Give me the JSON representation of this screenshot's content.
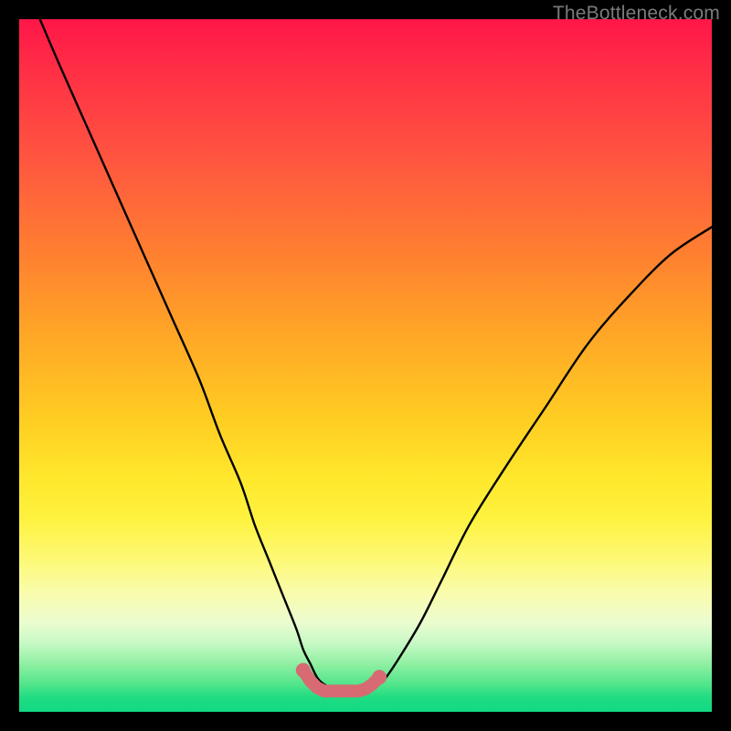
{
  "watermark": "TheBottleneck.com",
  "chart_data": {
    "type": "line",
    "title": "",
    "xlabel": "",
    "ylabel": "",
    "xlim": [
      0,
      100
    ],
    "ylim": [
      0,
      100
    ],
    "series": [
      {
        "name": "curve",
        "x": [
          3,
          6,
          10,
          14,
          18,
          22,
          26,
          29,
          32,
          34,
          36,
          38,
          40,
          41,
          42,
          43,
          44,
          46,
          48,
          50,
          52,
          53,
          55,
          58,
          61,
          65,
          70,
          76,
          82,
          88,
          94,
          100
        ],
        "y": [
          100,
          93,
          84,
          75,
          66,
          57,
          48,
          40,
          33,
          27,
          22,
          17,
          12,
          9,
          7,
          5,
          4,
          3,
          3,
          3,
          4,
          5,
          8,
          13,
          19,
          27,
          35,
          44,
          53,
          60,
          66,
          70
        ]
      },
      {
        "name": "bump-markers",
        "x": [
          41,
          42,
          43,
          44,
          45,
          46,
          47,
          48,
          49,
          50,
          51,
          52
        ],
        "y": [
          6,
          4.5,
          3.5,
          3,
          3,
          3,
          3,
          3,
          3,
          3.3,
          4,
          5
        ]
      }
    ],
    "gradient_stops": [
      {
        "pos": 0.0,
        "color": "#ff1648"
      },
      {
        "pos": 0.2,
        "color": "#ff5540"
      },
      {
        "pos": 0.46,
        "color": "#ffa826"
      },
      {
        "pos": 0.66,
        "color": "#ffe72c"
      },
      {
        "pos": 0.83,
        "color": "#f9fcae"
      },
      {
        "pos": 0.93,
        "color": "#91f0a3"
      },
      {
        "pos": 1.0,
        "color": "#12d983"
      }
    ],
    "marker_color": "#d76a72",
    "curve_color": "#000000"
  }
}
